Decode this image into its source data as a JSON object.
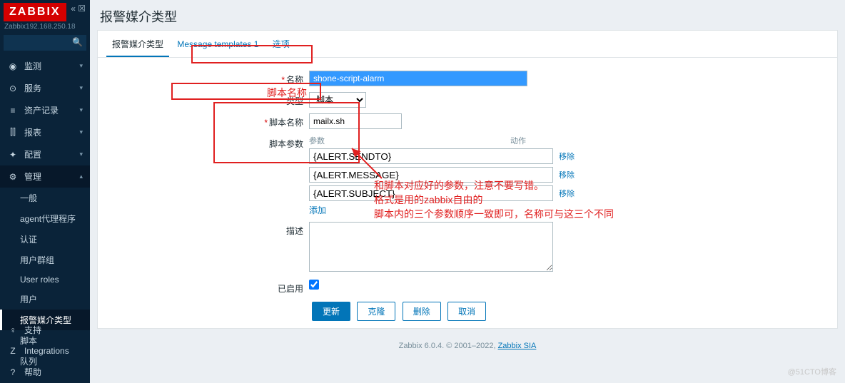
{
  "brand": {
    "logo": "ZABBIX",
    "host": "Zabbix192.168.250.18"
  },
  "sidebar": {
    "items": [
      {
        "icon": "◉",
        "label": "监测"
      },
      {
        "icon": "⊙",
        "label": "服务"
      },
      {
        "icon": "≡",
        "label": "资产记录"
      },
      {
        "icon": "⫿⫿",
        "label": "报表"
      },
      {
        "icon": "✦",
        "label": "配置"
      },
      {
        "icon": "⚙",
        "label": "管理"
      }
    ],
    "sub": [
      "一般",
      "agent代理程序",
      "认证",
      "用户群组",
      "User roles",
      "用户",
      "报警媒介类型",
      "脚本",
      "队列"
    ],
    "bottom": [
      {
        "icon": "♀",
        "label": "支持"
      },
      {
        "icon": "Z",
        "label": "Integrations"
      },
      {
        "icon": "?",
        "label": "帮助"
      }
    ]
  },
  "page": {
    "title": "报警媒介类型"
  },
  "tabs": {
    "t1": "报警媒介类型",
    "t2": "Message templates 1",
    "t3": "选项"
  },
  "form": {
    "name_label": "名称",
    "name_value": "shone-script-alarm",
    "type_label": "类型",
    "type_value": "脚本",
    "script_name_label": "脚本名称",
    "script_name_value": "mailx.sh",
    "params_label": "脚本参数",
    "params_header_col1": "参数",
    "params_header_col2": "动作",
    "params": [
      "{ALERT.SENDTO}",
      "{ALERT.MESSAGE}",
      "{ALERT.SUBJECT}"
    ],
    "remove": "移除",
    "add": "添加",
    "desc_label": "描述",
    "enabled_label": "已启用"
  },
  "buttons": {
    "update": "更新",
    "clone": "克隆",
    "delete": "删除",
    "cancel": "取消"
  },
  "footer": {
    "text": "Zabbix 6.0.4. © 2001–2022, ",
    "link": "Zabbix SIA"
  },
  "annotations": {
    "script_name": "脚本名称",
    "params_note_l1": "和脚本对应好的参数，注意不要写错。",
    "params_note_l2": "格式是用的zabbix自由的",
    "params_note_l3": "脚本内的三个参数顺序一致即可，名称可与这三个不同"
  },
  "watermark": "@51CTO博客"
}
